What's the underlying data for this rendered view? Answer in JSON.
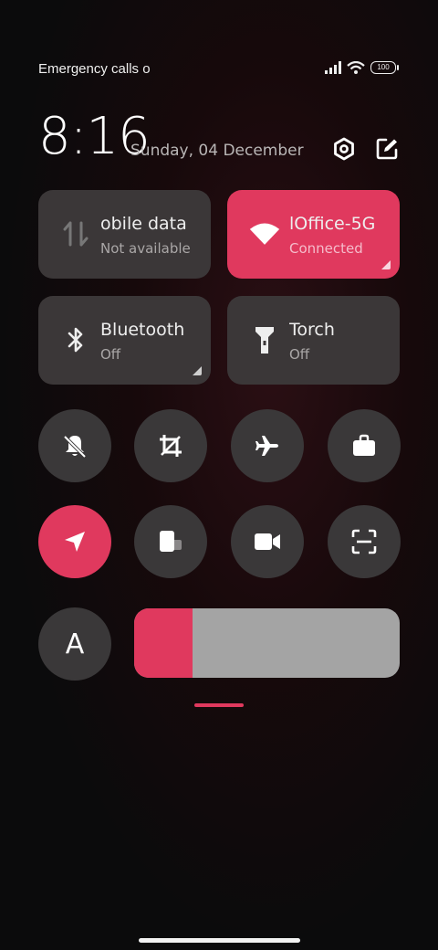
{
  "status_bar": {
    "carrier_text": "Emergency calls o",
    "battery": "100"
  },
  "header": {
    "time": "8:16",
    "date": "Sunday, 04 December"
  },
  "tiles": [
    {
      "title": "obile data",
      "subtitle": "Not available",
      "active": false
    },
    {
      "title": "lOffice-5G",
      "subtitle": "Connected",
      "active": true
    },
    {
      "title": "Bluetooth",
      "subtitle": "Off",
      "active": false
    },
    {
      "title": "Torch",
      "subtitle": "Off",
      "active": false
    }
  ],
  "toggles": [
    {
      "icon": "silent-bell-icon",
      "active": false
    },
    {
      "icon": "crop-icon",
      "active": false
    },
    {
      "icon": "airplane-icon",
      "active": false
    },
    {
      "icon": "briefcase-icon",
      "active": false
    },
    {
      "icon": "location-icon",
      "active": true
    },
    {
      "icon": "floating-window-icon",
      "active": false
    },
    {
      "icon": "video-camera-icon",
      "active": false
    },
    {
      "icon": "scanner-icon",
      "active": false
    }
  ],
  "auto_brightness_label": "A",
  "brightness_fraction": 0.22,
  "accent_color": "#e0395e"
}
